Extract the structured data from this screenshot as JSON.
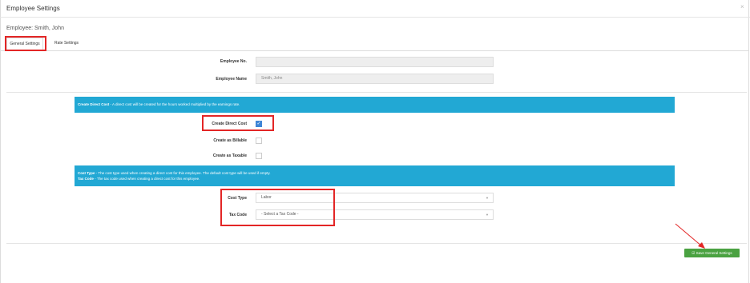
{
  "window": {
    "title": "Employee Settings",
    "close_glyph": "×"
  },
  "employee": {
    "label": "Employee: Smith, John"
  },
  "tabs": [
    {
      "label": "General Settings",
      "active": true
    },
    {
      "label": "Rate Settings",
      "active": false
    }
  ],
  "fields": {
    "employee_no": {
      "label": "Employee No.",
      "value": ""
    },
    "employee_name": {
      "label": "Employee Name",
      "value": "Smith, John"
    }
  },
  "banner1": {
    "bold": "Create Direct Cost",
    "text": " - A direct cost will be created for the hours worked multiplied by the earnings rate."
  },
  "checkboxes": [
    {
      "label": "Create Direct Cost",
      "checked": true
    },
    {
      "label": "Create as Billable",
      "checked": false
    },
    {
      "label": "Create as Taxable",
      "checked": false
    }
  ],
  "banner2": {
    "line1_bold": "Cost Type",
    "line1_text": " - The cost type used when creating a direct cost for this employee. The default cost type will be used if empty.",
    "line2_bold": "Tax Code",
    "line2_text": " - The tax code used when creating a direct cost for this employee."
  },
  "selects": {
    "cost_type": {
      "label": "Cost Type",
      "value": "Labor"
    },
    "tax_code": {
      "label": "Tax Code",
      "value": "- Select a Tax Code -"
    }
  },
  "save_button": {
    "label": "Save General Settings",
    "icon": "check-square-icon"
  },
  "colors": {
    "banner": "#22a8d4",
    "save": "#4aa241",
    "annotation": "#e32626",
    "checkbox_checked": "#3f86d6"
  }
}
